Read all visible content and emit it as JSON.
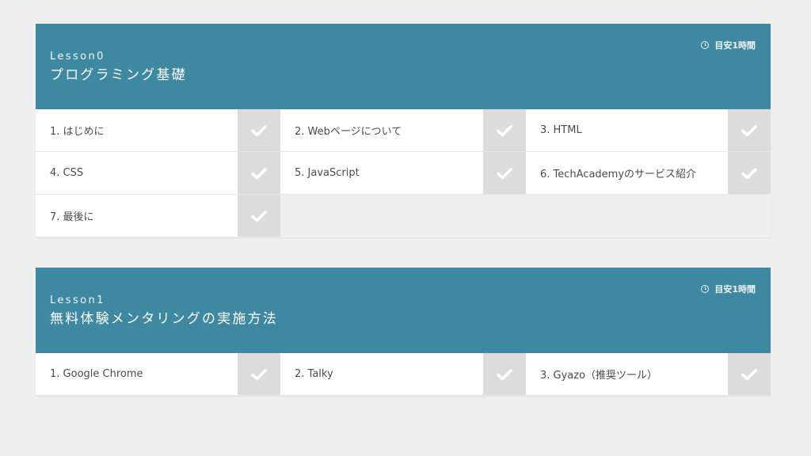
{
  "lessons": [
    {
      "number_label": "Lesson0",
      "title": "プログラミング基礎",
      "duration": "目安1時間",
      "duration_icon": "clock-icon",
      "chapters": [
        {
          "label": "1. はじめに",
          "completed": true
        },
        {
          "label": "2. Webページについて",
          "completed": true
        },
        {
          "label": "3. HTML",
          "completed": true
        },
        {
          "label": "4. CSS",
          "completed": true
        },
        {
          "label": "5. JavaScript",
          "completed": true
        },
        {
          "label": "6. TechAcademyのサービス紹介",
          "completed": true
        },
        {
          "label": "7. 最後に",
          "completed": true
        }
      ]
    },
    {
      "number_label": "Lesson1",
      "title": "無料体験メンタリングの実施方法",
      "duration": "目安1時間",
      "duration_icon": "clock-icon",
      "chapters": [
        {
          "label": "1. Google Chrome",
          "completed": true
        },
        {
          "label": "2. Talky",
          "completed": true
        },
        {
          "label": "3. Gyazo（推奨ツール）",
          "completed": true
        }
      ]
    }
  ],
  "colors": {
    "header_bg": "#3f88a1",
    "page_bg": "#efefef",
    "check_bg": "#dcdcdc",
    "check_mark": "#ffffff",
    "item_text": "#4a4a4a"
  }
}
